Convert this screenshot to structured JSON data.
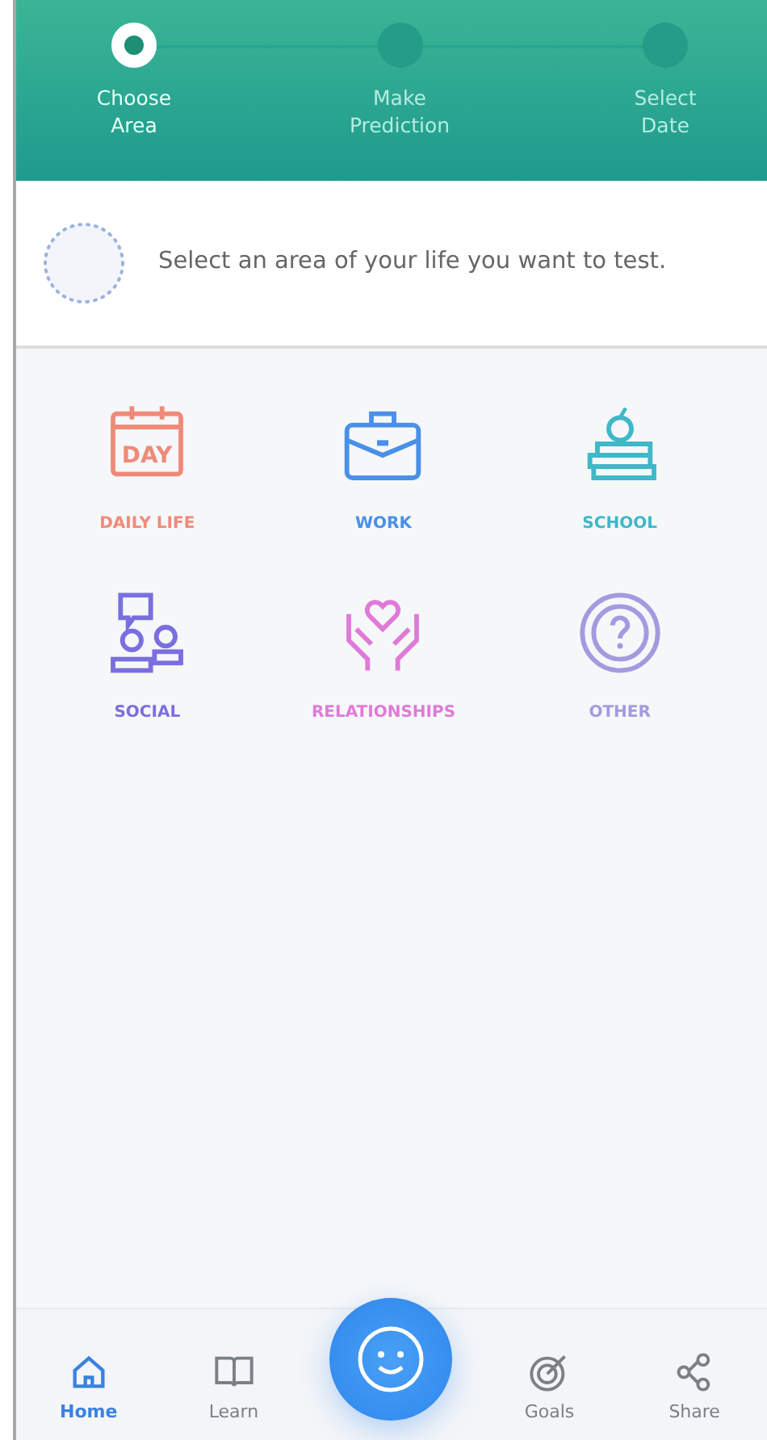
{
  "steps": [
    {
      "label": "Choose Area",
      "selected": true
    },
    {
      "label": "Make Prediction",
      "selected": false
    },
    {
      "label": "Select Date",
      "selected": false
    }
  ],
  "prompt": {
    "text": "Select an area of your life you want to test."
  },
  "areas": [
    {
      "kind": "calendar",
      "label": "DAILY LIFE",
      "icon_text": "DAY",
      "color": "#f08a78"
    },
    {
      "kind": "briefcase",
      "label": "WORK",
      "color": "#4a90e8"
    },
    {
      "kind": "books",
      "label": "SCHOOL",
      "color": "#3fb8c8"
    },
    {
      "kind": "social",
      "label": "SOCIAL",
      "color": "#7a6fe0"
    },
    {
      "kind": "hands",
      "label": "RELATIONSHIPS",
      "color": "#e07ad8"
    },
    {
      "kind": "question",
      "label": "OTHER",
      "color": "#a49ae0"
    }
  ],
  "nav": [
    {
      "kind": "home",
      "label": "Home",
      "selected": true
    },
    {
      "kind": "book",
      "label": "Learn",
      "selected": false
    },
    {
      "kind": "smile"
    },
    {
      "kind": "target",
      "label": "Goals",
      "selected": false
    },
    {
      "kind": "share",
      "label": "Share",
      "selected": false
    }
  ]
}
